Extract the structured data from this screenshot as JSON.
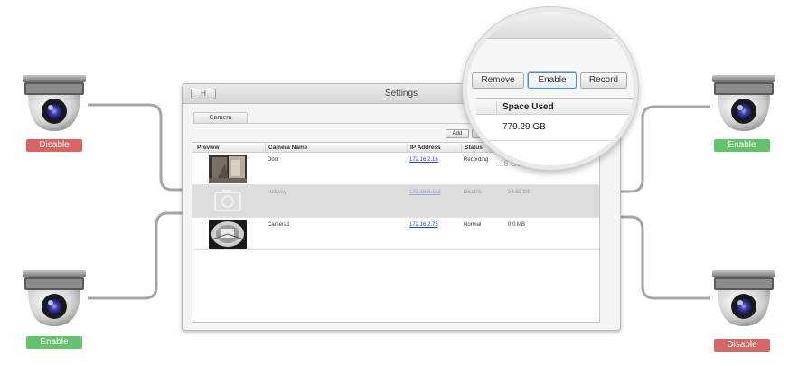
{
  "window": {
    "title": "Settings",
    "title_button": "H",
    "tab": "Camera",
    "add_label": "Add"
  },
  "table": {
    "headers": [
      "Preview",
      "Camera Name",
      "IP Address",
      "Status"
    ],
    "rows": [
      {
        "name": "Door",
        "ip": "172.16.2.16",
        "status": "Recording",
        "space": "...8 GB",
        "state": "normal"
      },
      {
        "name": "Hallway",
        "ip": "172.16.8.112",
        "status": "Disable",
        "space": "34.93 GB",
        "state": "disabled"
      },
      {
        "name": "Camera1",
        "ip": "172.16.2.75",
        "status": "Normal",
        "space": "0.0 MB",
        "state": "normal"
      }
    ]
  },
  "magnifier": {
    "buttons": [
      "Remove",
      "Enable",
      "Record"
    ],
    "column": "Space Used",
    "value": "779.29 GB"
  },
  "badges": {
    "left_top": "Disable",
    "left_bottom": "Enable",
    "right_top": "Enable",
    "right_bottom": "Disable"
  },
  "colors": {
    "disable": "#d86464",
    "enable": "#63c26c",
    "link": "#1f3fd0",
    "connector": "#a5a5a5"
  },
  "icons": [
    "security-camera-icon",
    "camera-placeholder-icon"
  ]
}
